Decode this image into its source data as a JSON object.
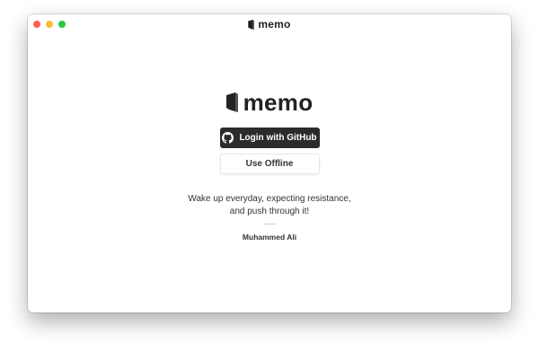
{
  "window": {
    "title": "memo",
    "traffic_lights": {
      "close": "#fe5f57",
      "minimize": "#febc2e",
      "zoom": "#28c840"
    }
  },
  "brand": {
    "name": "memo",
    "logo_icon": "book-icon"
  },
  "auth": {
    "github_label": "Login with GitHub",
    "github_icon": "github-icon",
    "offline_label": "Use Offline"
  },
  "quote": {
    "line1": "Wake up everyday, expecting resistance,",
    "line2": "and push through it!",
    "author": "Muhammed Ali"
  }
}
